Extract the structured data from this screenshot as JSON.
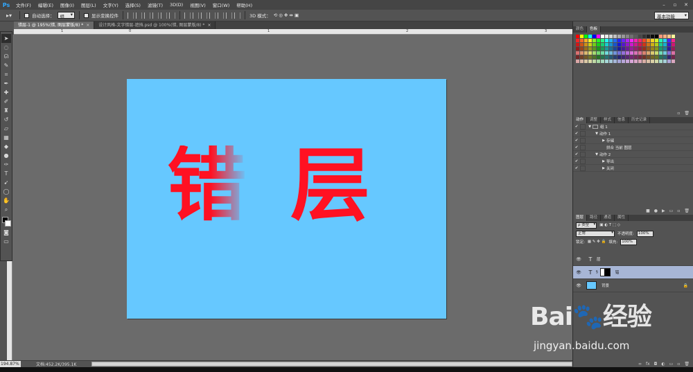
{
  "app": {
    "logo": "Ps"
  },
  "menu": [
    "文件(F)",
    "编辑(E)",
    "图像(I)",
    "图层(L)",
    "文字(Y)",
    "选择(S)",
    "滤镜(T)",
    "3D(D)",
    "视图(V)",
    "窗口(W)",
    "帮助(H)"
  ],
  "options": {
    "auto_select": "自动选择：",
    "auto_select_value": "组",
    "show_transform": "显示变换控件",
    "mode_3d": "3D 模式：",
    "workspace": "基本功能"
  },
  "tabs": [
    {
      "title": "错层-1 @ 195%(错, 图层蒙版/8) *"
    },
    {
      "title": "设计风格-文字错层-遮挡.psd @ 100%(错, 图层蒙版/8) *"
    }
  ],
  "ruler": {
    "h": [
      "1",
      "0",
      "1",
      "2",
      "3"
    ]
  },
  "canvas": {
    "background_color": "#66c8ff",
    "text_color": "#ff1122",
    "char_1": "错",
    "char_2": "层"
  },
  "status": {
    "zoom": "194.87%",
    "doc_size": "文档:452.2K/395.1K"
  },
  "panels": {
    "color": {
      "tabs": [
        "颜色",
        "色板"
      ],
      "swatches": [
        "#ff0000",
        "#ffff00",
        "#00ff00",
        "#00ffff",
        "#0000ff",
        "#ff00ff",
        "#ffffff",
        "#ebebeb",
        "#d6d6d6",
        "#c2c2c2",
        "#adadad",
        "#999999",
        "#858585",
        "#707070",
        "#5c5c5c",
        "#474747",
        "#333333",
        "#1f1f1f",
        "#0a0a0a",
        "#000000",
        "#f7977a",
        "#f9ad81",
        "#fdc68a",
        "#fff79a"
      ]
    },
    "actions": {
      "tabs": [
        "动作",
        "调整",
        "样式",
        "信息",
        "历史记录"
      ],
      "rows": [
        "组 1",
        "动作 1",
        "存储",
        "拼合 当前 图层",
        "动作 2",
        "导出",
        "关闭"
      ]
    },
    "layers": {
      "tabs": [
        "图层",
        "路径",
        "通道",
        "属性"
      ],
      "filter": "ρ 类型",
      "blend_mode": "正常",
      "opacity_label": "不透明度:",
      "opacity": "100%",
      "lock_label": "锁定:",
      "fill_label": "填充:",
      "fill": "100%",
      "items": [
        "层",
        "错",
        "背景"
      ]
    }
  },
  "watermark": {
    "brand": "Bai🐾经验",
    "url": "jingyan.baidu.com"
  }
}
